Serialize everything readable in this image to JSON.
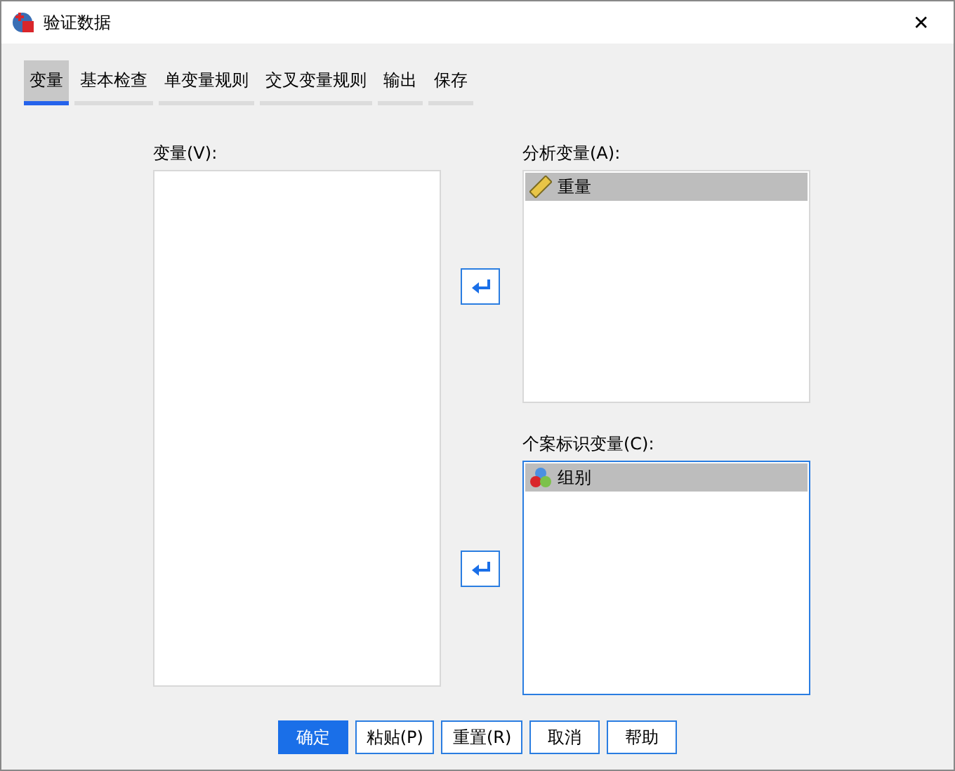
{
  "window": {
    "title": "验证数据",
    "close": "✕"
  },
  "tabs": [
    {
      "label": "变量",
      "selected": true
    },
    {
      "label": "基本检查",
      "selected": false
    },
    {
      "label": "单变量规则",
      "selected": false
    },
    {
      "label": "交叉变量规则",
      "selected": false
    },
    {
      "label": "输出",
      "selected": false
    },
    {
      "label": "保存",
      "selected": false
    }
  ],
  "source_list": {
    "label": "变量(V):"
  },
  "target_lists": [
    {
      "label": "分析变量(A):",
      "focused": false,
      "items": [
        {
          "name": "重量",
          "kind": "scale",
          "selected": true
        }
      ]
    },
    {
      "label": "个案标识变量(C):",
      "focused": true,
      "items": [
        {
          "name": "组别",
          "kind": "nominal",
          "selected": true
        }
      ]
    }
  ],
  "buttons": [
    {
      "label": "确定",
      "primary": true
    },
    {
      "label": "粘贴(P)",
      "primary": false
    },
    {
      "label": "重置(R)",
      "primary": false
    },
    {
      "label": "取消",
      "primary": false
    },
    {
      "label": "帮助",
      "primary": false
    }
  ]
}
